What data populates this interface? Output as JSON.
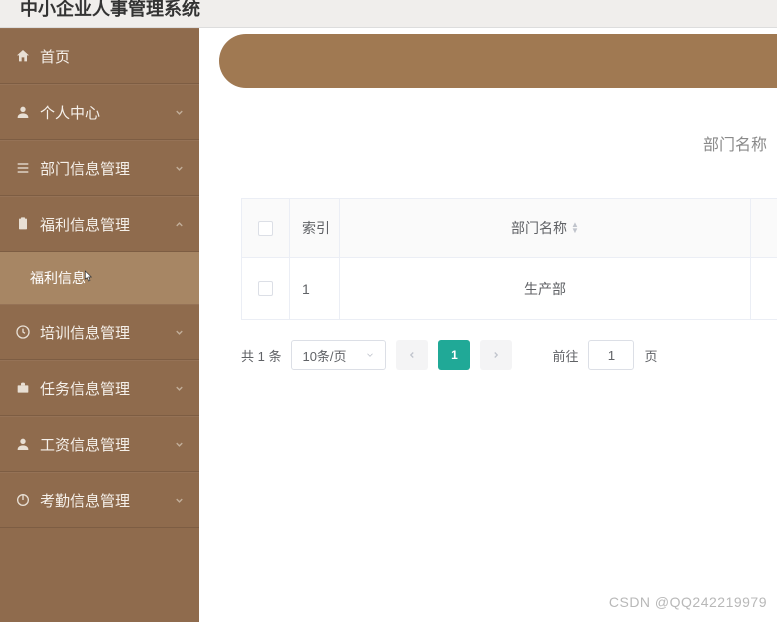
{
  "header": {
    "title": "中小企业人事管理系统"
  },
  "sidebar": {
    "items": [
      {
        "label": "首页",
        "icon": "home-icon",
        "expandable": false
      },
      {
        "label": "个人中心",
        "icon": "user-icon",
        "expandable": true
      },
      {
        "label": "部门信息管理",
        "icon": "list-icon",
        "expandable": true
      },
      {
        "label": "福利信息管理",
        "icon": "clipboard-icon",
        "expandable": true,
        "expanded": true,
        "children": [
          {
            "label": "福利信息"
          }
        ]
      },
      {
        "label": "培训信息管理",
        "icon": "clock-icon",
        "expandable": true
      },
      {
        "label": "任务信息管理",
        "icon": "briefcase-icon",
        "expandable": true
      },
      {
        "label": "工资信息管理",
        "icon": "user-icon",
        "expandable": true
      },
      {
        "label": "考勤信息管理",
        "icon": "power-icon",
        "expandable": true
      }
    ]
  },
  "main": {
    "filter_label": "部门名称",
    "table": {
      "columns": {
        "index": "索引",
        "dept": "部门名称"
      },
      "rows": [
        {
          "index": "1",
          "dept": "生产部"
        }
      ]
    },
    "pagination": {
      "total_text": "共 1 条",
      "page_size": "10条/页",
      "current": "1",
      "goto_prefix": "前往",
      "goto_value": "1",
      "goto_suffix": "页"
    }
  },
  "watermark": "CSDN @QQ242219979"
}
